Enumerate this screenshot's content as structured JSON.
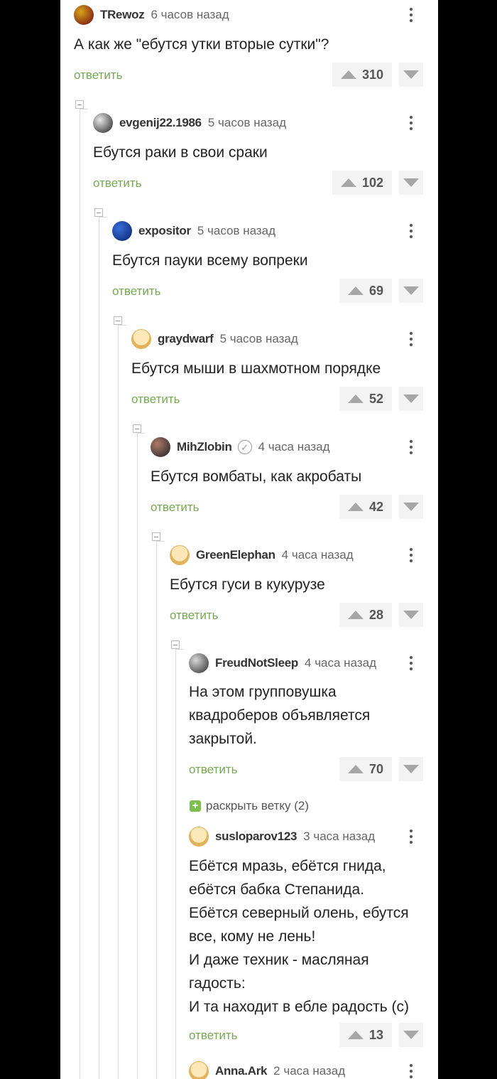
{
  "comments": [
    {
      "user": "TRewoz",
      "time": "6 часов назад",
      "body": "А как же \"ебутся утки вторые сутки\"?",
      "reply": "ответить",
      "score": "310",
      "avatar_colors": [
        "#d7a31a",
        "#7a1414"
      ],
      "avatar_icon": "avatar-image"
    },
    {
      "user": "evgenij22.1986",
      "time": "5 часов назад",
      "body": "Ебутся раки в свои сраки",
      "reply": "ответить",
      "score": "102",
      "avatar_colors": [
        "#e8e8e8",
        "#333333"
      ],
      "avatar_icon": "avatar-image"
    },
    {
      "user": "expositor",
      "time": "5 часов назад",
      "body": "Ебутся пауки всему вопреки",
      "reply": "ответить",
      "score": "69",
      "avatar_colors": [
        "#3b6fd6",
        "#0b2a7a"
      ],
      "avatar_icon": "avatar-image"
    },
    {
      "user": "graydwarf",
      "time": "5 часов назад",
      "body": "Ебутся мыши в шахмотном порядке",
      "reply": "ответить",
      "score": "52",
      "avatar_colors": [
        "#fbe7b8",
        "#e3b25c"
      ],
      "avatar_icon": "default-avatar"
    },
    {
      "user": "MihZlobin",
      "time": "4 часа назад",
      "body": "Ебутся вомбаты, как акробаты",
      "reply": "ответить",
      "score": "42",
      "verified": "✓",
      "avatar_colors": [
        "#b07a6a",
        "#2a2a2a"
      ],
      "avatar_icon": "avatar-image"
    },
    {
      "user": "GreenElephan",
      "time": "4 часа назад",
      "body": "Ебутся гуси в кукурузе",
      "reply": "ответить",
      "score": "28",
      "avatar_colors": [
        "#fbe7b8",
        "#e3b25c"
      ],
      "avatar_icon": "default-avatar"
    },
    {
      "user": "FreudNotSleep",
      "time": "4 часа назад",
      "body_lines": [
        "На этом групповушка",
        "квадроберов объявляется",
        "закрытой."
      ],
      "reply": "ответить",
      "score": "70",
      "avatar_colors": [
        "#d8d8d8",
        "#3a3a3a"
      ],
      "avatar_icon": "avatar-image"
    },
    {
      "user": "susloparov123",
      "time": "3 часа назад",
      "body_lines": [
        "Ебётся мразь, ебётся гнида,",
        "ебётся бабка Степанида.",
        "Ебётся северный олень, ебутся",
        "все, кому не лень!",
        "И даже техник - масляная",
        "гадость:",
        "И та находит в ебле радость (с)"
      ],
      "reply": "ответить",
      "score": "13",
      "avatar_colors": [
        "#fbe7b8",
        "#e3b25c"
      ],
      "avatar_icon": "default-avatar"
    },
    {
      "user": "Anna.Ark",
      "time": "2 часа назад",
      "avatar_colors": [
        "#fbe7b8",
        "#e3b25c"
      ],
      "avatar_icon": "default-avatar"
    }
  ],
  "expand_branch": {
    "label": "раскрыть ветку (2)",
    "icon": "plus-icon"
  },
  "colors": {
    "reply_link": "#76a853",
    "panel_bg": "#ffffff",
    "page_bg": "#000000",
    "rating_bg": "#f3f3f3"
  }
}
